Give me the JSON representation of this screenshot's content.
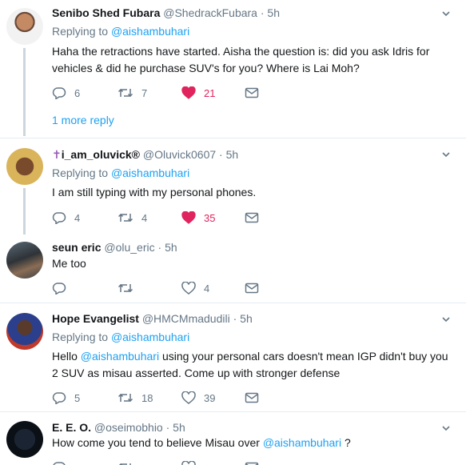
{
  "tweets": [
    {
      "name": "Senibo Shed Fubara",
      "handle": "@ShedrackFubara",
      "dot": "·",
      "time": "5h",
      "replying_label": "Replying to",
      "replying_to": "@aishambuhari",
      "text": "Haha the retractions have started. Aisha the question is: did you ask Idris for vehicles & did he purchase SUV's for you? Where is Lai Moh?",
      "replies": "6",
      "retweets": "7",
      "likes": "21",
      "liked": true,
      "more_reply": "1 more reply"
    },
    {
      "name_prefix": "✝",
      "name": "i_am_oluvick®",
      "handle": "@Oluvick0607",
      "dot": "·",
      "time": "5h",
      "replying_label": "Replying to",
      "replying_to": "@aishambuhari",
      "text": "I am still typing with my personal phones.",
      "replies": "4",
      "retweets": "4",
      "likes": "35",
      "liked": true
    },
    {
      "name": "seun eric",
      "handle": "@olu_eric",
      "dot": "·",
      "time": "5h",
      "text": "Me too",
      "replies": "",
      "retweets": "",
      "likes": "4",
      "liked": false
    },
    {
      "name": "Hope Evangelist",
      "handle": "@HMCMmadudili",
      "dot": "·",
      "time": "5h",
      "replying_label": "Replying to",
      "replying_to": "@aishambuhari",
      "text_parts": [
        "Hello ",
        "@aishambuhari",
        " using your personal cars doesn't mean IGP didn't buy you 2 SUV as misau  asserted. Come up with stronger defense"
      ],
      "replies": "5",
      "retweets": "18",
      "likes": "39",
      "liked": false
    },
    {
      "name": "E. E. O.",
      "handle": "@oseimobhio",
      "dot": "·",
      "time": "5h",
      "text_parts": [
        "How come you tend to believe Misau over ",
        "@aishambuhari",
        " ?"
      ],
      "replies": "",
      "retweets": "",
      "likes": "",
      "liked": false
    }
  ],
  "colors": {
    "accent": "#1da1f2",
    "like": "#e0245e",
    "muted": "#657786",
    "text": "#14171a",
    "separator": "#e6ecf0"
  },
  "icons": [
    "reply-icon",
    "retweet-icon",
    "heart-icon",
    "dm-icon",
    "caret-down-icon"
  ]
}
